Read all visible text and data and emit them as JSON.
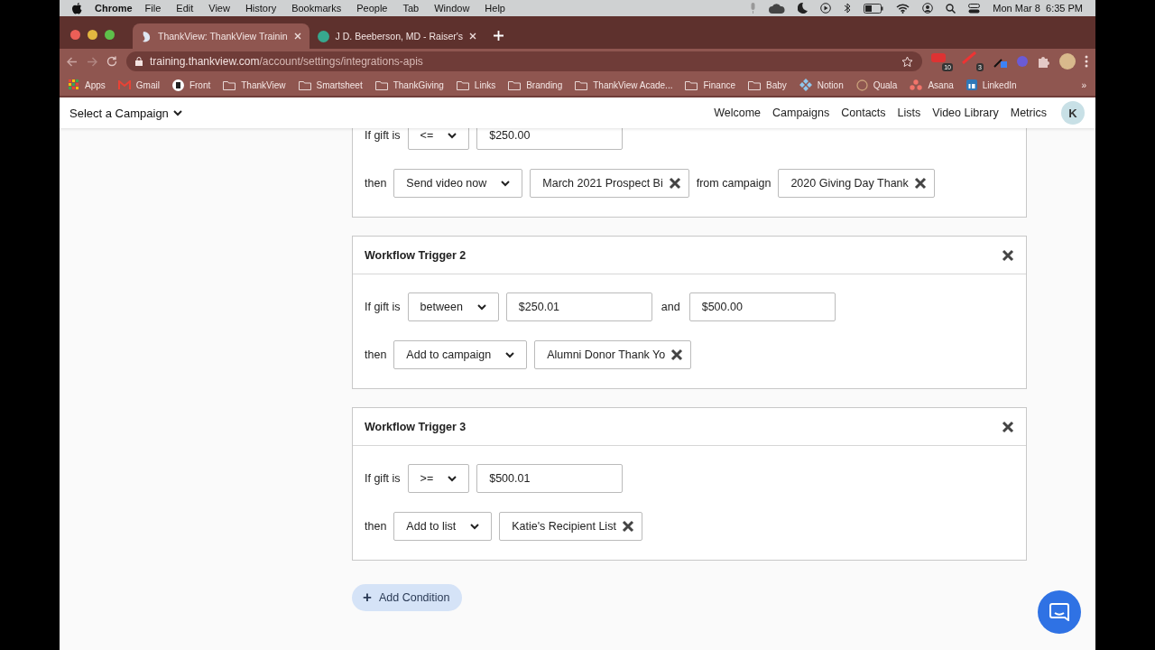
{
  "menubar": {
    "app": "Chrome",
    "menus": [
      "File",
      "Edit",
      "View",
      "History",
      "Bookmarks",
      "People",
      "Tab",
      "Window",
      "Help"
    ],
    "clock": "Mon Mar 8  6:35 PM"
  },
  "browser": {
    "tabs": [
      {
        "title": "ThankView: ThankView Trainin",
        "selected": true
      },
      {
        "title": "J D. Beeberson, MD - Raiser's",
        "selected": false
      }
    ],
    "url_host": "training.thankview.com",
    "url_path": "/account/settings/integrations-apis",
    "extension_badges": [
      "10",
      "3"
    ],
    "bookmarks": [
      {
        "label": "Apps",
        "kind": "apps"
      },
      {
        "label": "Gmail",
        "kind": "gmail"
      },
      {
        "label": "Front",
        "kind": "front"
      },
      {
        "label": "ThankView",
        "kind": "folder"
      },
      {
        "label": "Smartsheet",
        "kind": "folder"
      },
      {
        "label": "ThankGiving",
        "kind": "folder"
      },
      {
        "label": "Links",
        "kind": "folder"
      },
      {
        "label": "Branding",
        "kind": "folder"
      },
      {
        "label": "ThankView Acade...",
        "kind": "folder"
      },
      {
        "label": "Finance",
        "kind": "folder"
      },
      {
        "label": "Baby",
        "kind": "folder"
      },
      {
        "label": "Notion",
        "kind": "notion"
      },
      {
        "label": "Quala",
        "kind": "quala"
      },
      {
        "label": "Asana",
        "kind": "asana"
      },
      {
        "label": "LinkedIn",
        "kind": "linkedin"
      }
    ],
    "bookmarks_more": "»"
  },
  "nav": {
    "campaign_select": "Select a Campaign",
    "links": [
      "Welcome",
      "Campaigns",
      "Contacts",
      "Lists",
      "Video Library",
      "Metrics"
    ],
    "avatar": "K"
  },
  "triggers": [
    {
      "condition": {
        "label": "If gift is",
        "operator": "<=",
        "values": [
          "$250.00"
        ]
      },
      "action": {
        "label": "then",
        "select": "Send video now",
        "tag": "March 2021 Prospect Bi",
        "from_label": "from campaign",
        "from_tag": "2020 Giving Day Thank"
      }
    },
    {
      "title": "Workflow Trigger 2",
      "condition": {
        "label": "If gift is",
        "operator": "between",
        "values": [
          "$250.01",
          "$500.00"
        ],
        "joiner": "and"
      },
      "action": {
        "label": "then",
        "select": "Add to campaign",
        "tag": "Alumni Donor Thank Yo"
      }
    },
    {
      "title": "Workflow Trigger 3",
      "condition": {
        "label": "If gift is",
        "operator": ">=",
        "values": [
          "$500.01"
        ]
      },
      "action": {
        "label": "then",
        "select": "Add to list",
        "tag": "Katie's Recipient List"
      }
    }
  ],
  "add_condition": {
    "icon": "+",
    "label": "Add Condition"
  }
}
